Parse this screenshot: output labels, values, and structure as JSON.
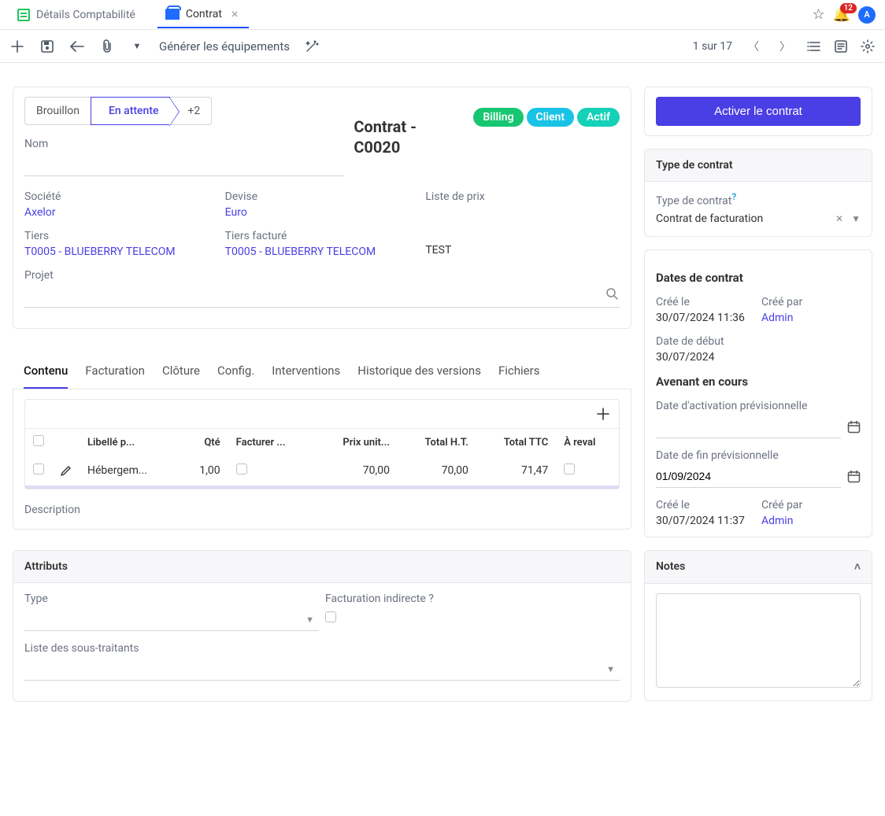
{
  "tabs": {
    "accounting": "Détails Comptabilité",
    "contract": "Contrat"
  },
  "topbar": {
    "badge_count": "12",
    "avatar_letter": "A"
  },
  "toolbar": {
    "generate_equip": "Générer les équipements",
    "pager": "1 sur 17"
  },
  "status": {
    "draft": "Brouillon",
    "pending": "En attente",
    "more": "+2"
  },
  "header": {
    "title_line1": "Contrat -",
    "title_line2": "C0020"
  },
  "badges": {
    "billing": "Billing",
    "client": "Client",
    "actif": "Actif"
  },
  "labels": {
    "name": "Nom",
    "company": "Société",
    "currency": "Devise",
    "pricelist": "Liste de prix",
    "tiers": "Tiers",
    "billed_tiers": "Tiers facturé",
    "project": "Projet",
    "description": "Description",
    "type": "Type",
    "indirect_billing": "Facturation indirecte ?",
    "subcontractors": "Liste des sous-traitants"
  },
  "values": {
    "company": "Axelor",
    "currency": "Euro",
    "tiers": "T0005 - BLUEBERRY TELECOM",
    "billed_tiers": "T0005 - BLUEBERRY TELECOM",
    "pricelist_note": "TEST"
  },
  "subtabs": {
    "content": "Contenu",
    "billing": "Facturation",
    "closure": "Clôture",
    "config": "Config.",
    "interventions": "Interventions",
    "versions": "Historique des versions",
    "files": "Fichiers"
  },
  "table": {
    "cols": {
      "label": "Libellé p...",
      "qty": "Qté",
      "bill": "Facturer ...",
      "unit_price": "Prix unit...",
      "total_ht": "Total H.T.",
      "total_ttc": "Total TTC",
      "reval": "À reval"
    },
    "row": {
      "label": "Hébergem...",
      "qty": "1,00",
      "unit_price": "70,00",
      "total_ht": "70,00",
      "total_ttc": "71,47"
    }
  },
  "attributes_title": "Attributs",
  "side": {
    "activate": "Activer le contrat",
    "type_title": "Type de contrat",
    "type_label": "Type de contrat",
    "type_value": "Contrat de facturation",
    "dates_title": "Dates de contrat",
    "created_on_label": "Créé le",
    "created_on_value": "30/07/2024 11:36",
    "created_by_label": "Créé par",
    "created_by_value": "Admin",
    "start_date_label": "Date de début",
    "start_date_value": "30/07/2024",
    "amendment_title": "Avenant en cours",
    "planned_activation_label": "Date d'activation prévisionnelle",
    "planned_end_label": "Date de fin prévisionnelle",
    "planned_end_value": "01/09/2024",
    "amend_created_on": "30/07/2024 11:37",
    "amend_created_by": "Admin",
    "notes_title": "Notes"
  }
}
